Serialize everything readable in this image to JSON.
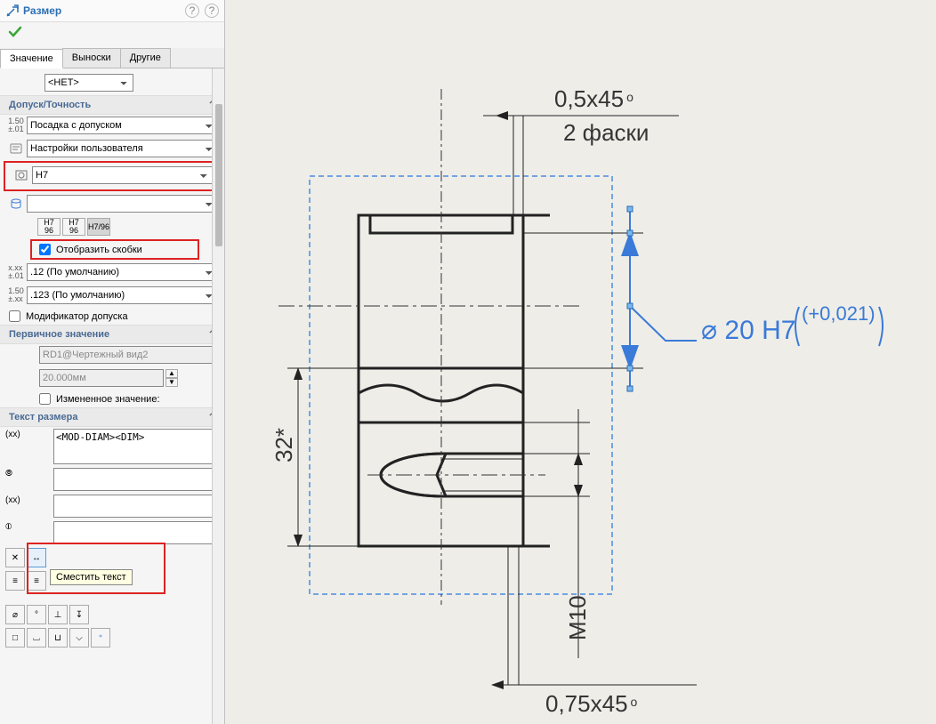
{
  "header": {
    "title": "Размер"
  },
  "tabs": {
    "value": "Значение",
    "leaders": "Выноски",
    "other": "Другие"
  },
  "top_select": "<НЕТ>",
  "sections": {
    "tolerance": {
      "title": "Допуск/Точность",
      "fit_with_tol": "Посадка с допуском",
      "user_settings": "Настройки пользователя",
      "hole_fit": "H7",
      "shaft_fit": "",
      "show_brackets": "Отобразить скобки",
      "prec1": ".12 (По умолчанию)",
      "prec2": ".123 (По умолчанию)",
      "modifier": "Модификатор допуска"
    },
    "primary": {
      "title": "Первичное значение",
      "name": "RD1@Чертежный вид2",
      "value": "20.000мм",
      "changed": "Измененное значение:"
    },
    "dim_text": {
      "title": "Текст размера",
      "text": "<MOD-DIAM><DIM>",
      "tooltip": "Сместить текст"
    }
  },
  "drawing": {
    "chamfer_top": "0,5x45",
    "chamfer_count": "2 фаски",
    "height": "32*",
    "thread": "M10",
    "chamfer_bottom": "0,75x45",
    "dim": "20 H7",
    "tol_upper": "+0,021"
  },
  "fit_buttons": {
    "a": "H7\n96",
    "b": "H7\n96",
    "c": "H7/96"
  }
}
